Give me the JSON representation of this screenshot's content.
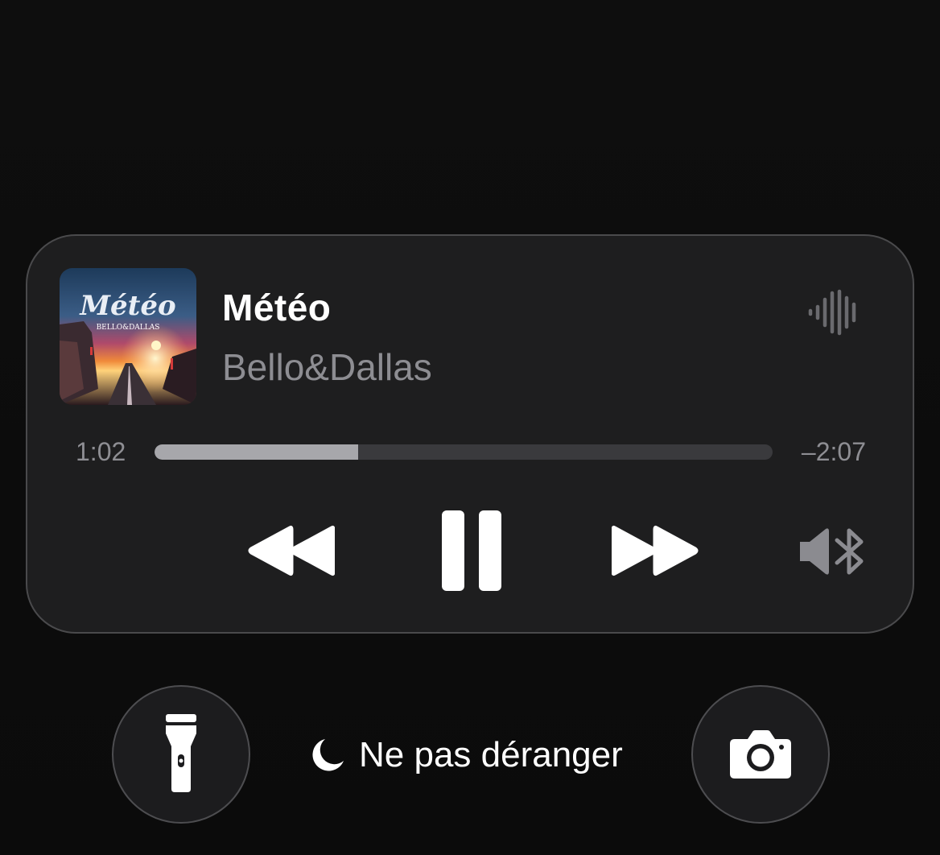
{
  "now_playing": {
    "title": "Météo",
    "artist": "Bello&Dallas",
    "artwork": {
      "title_text": "Météo",
      "subtitle_text": "BELLO&DALLAS"
    },
    "elapsed": "1:02",
    "remaining": "–2:07",
    "progress_fraction": 0.33
  },
  "controls": {
    "rewind_icon": "rewind-icon",
    "pause_icon": "pause-icon",
    "forward_icon": "fast-forward-icon",
    "audio_route_icon": "speaker-bluetooth-icon",
    "waveform_icon": "waveform-icon"
  },
  "bottom_bar": {
    "flashlight_icon": "flashlight-icon",
    "dnd_icon": "moon-icon",
    "dnd_label": "Ne pas déranger",
    "camera_icon": "camera-icon"
  },
  "colors": {
    "background": "#0d0d0d",
    "card": "#1e1e1f",
    "secondary_text": "#8d8d92",
    "progress_fill": "#a7a7ab",
    "progress_track": "#3a3a3d"
  }
}
